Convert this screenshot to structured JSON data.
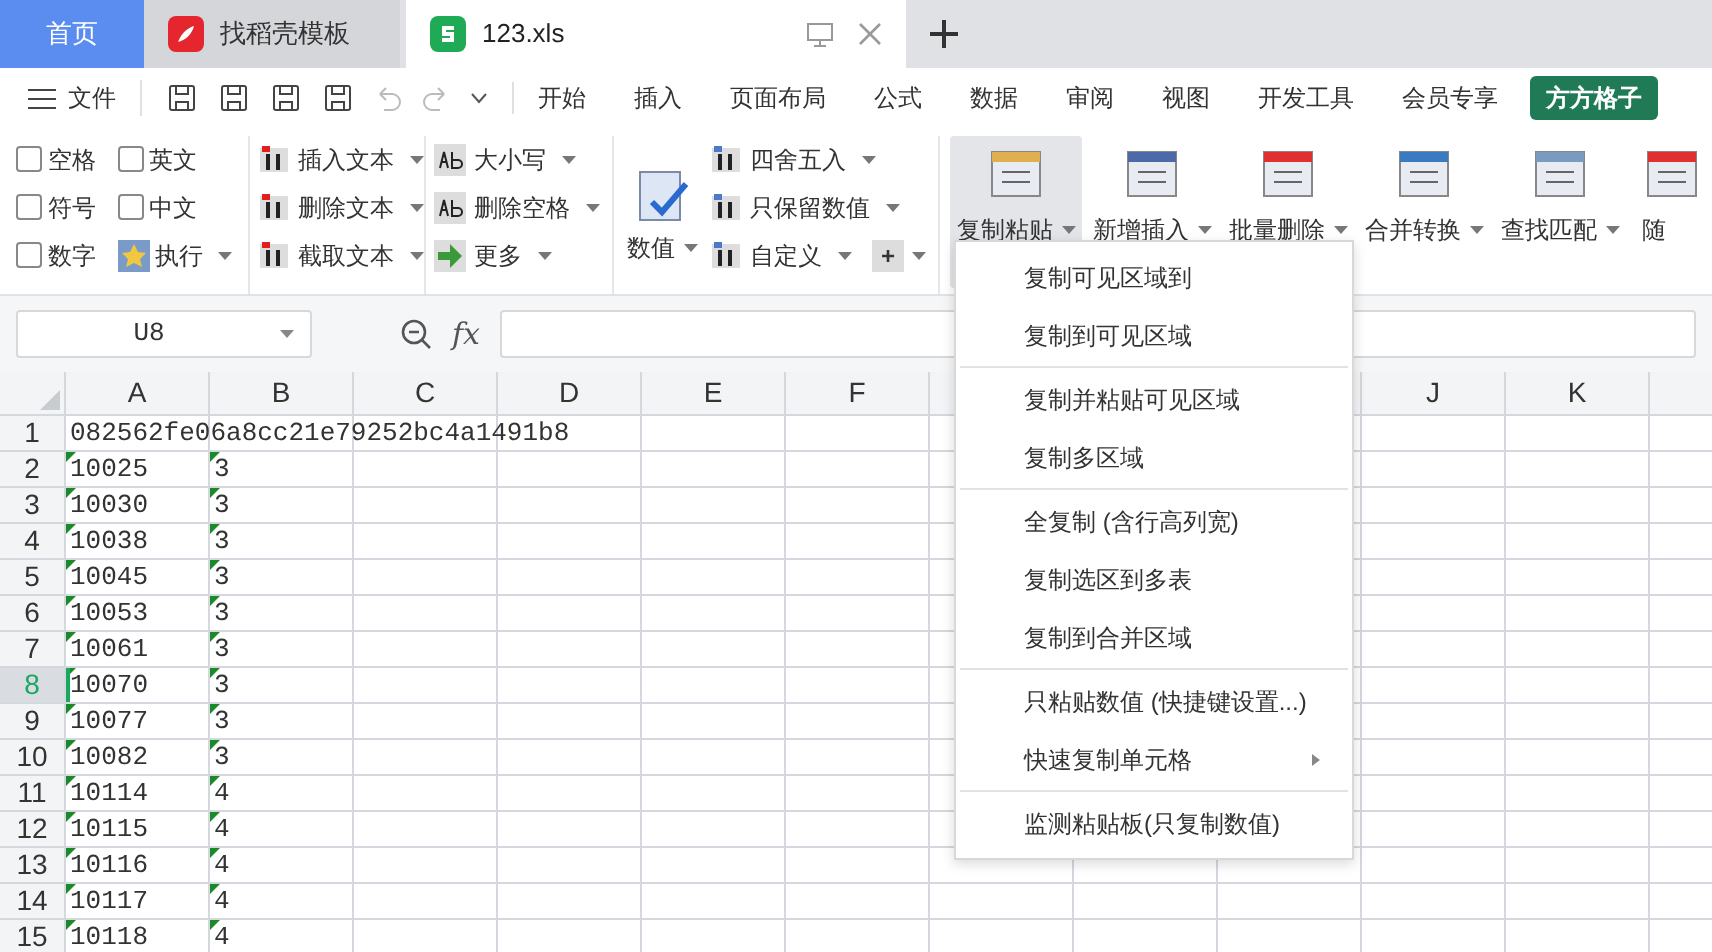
{
  "tabs": [
    {
      "label": "首页",
      "kind": "home",
      "selected": false
    },
    {
      "label": "找稻壳模板",
      "kind": "template",
      "selected": false
    },
    {
      "label": "123.xls",
      "kind": "sheet",
      "selected": true
    }
  ],
  "menu": {
    "file": "文件",
    "tabs": [
      "开始",
      "插入",
      "页面布局",
      "公式",
      "数据",
      "审阅",
      "视图",
      "开发工具",
      "会员专享"
    ],
    "brand": "方方格子"
  },
  "ribbon": {
    "checkboxes": [
      {
        "label": "空格",
        "checked": false
      },
      {
        "label": "英文",
        "checked": false
      },
      {
        "label": "符号",
        "checked": false
      },
      {
        "label": "中文",
        "checked": false
      },
      {
        "label": "数字",
        "checked": false
      }
    ],
    "execute": "执行",
    "text_tools": [
      "插入文本",
      "删除文本",
      "截取文本"
    ],
    "case_tools": [
      "大小写",
      "删除空格",
      "更多"
    ],
    "value_big": "数值",
    "value_tools": [
      "四舍五入",
      "只保留数值",
      "自定义"
    ],
    "plus": "+",
    "big_buttons": [
      {
        "label": "复制粘贴",
        "selected": true
      },
      {
        "label": "新增插入",
        "selected": false
      },
      {
        "label": "批量删除",
        "selected": false
      },
      {
        "label": "合并转换",
        "selected": false
      },
      {
        "label": "查找匹配",
        "selected": false
      },
      {
        "label": "随",
        "selected": false
      }
    ]
  },
  "formula_bar": {
    "name_box": "U8",
    "fx": "fx"
  },
  "columns": [
    {
      "label": "A"
    },
    {
      "label": "B"
    },
    {
      "label": "C"
    },
    {
      "label": "D"
    },
    {
      "label": "E"
    },
    {
      "label": "F"
    },
    {
      "label": "J"
    },
    {
      "label": "K"
    }
  ],
  "rows": [
    {
      "n": "1",
      "a": "082562fe06a8cc21e79252bc4a1491b8",
      "selected": false
    },
    {
      "n": "2",
      "a": "10025",
      "b": "3",
      "selected": false,
      "text_marker": true
    },
    {
      "n": "3",
      "a": "10030",
      "b": "3",
      "selected": false,
      "text_marker": true
    },
    {
      "n": "4",
      "a": "10038",
      "b": "3",
      "selected": false,
      "text_marker": true
    },
    {
      "n": "5",
      "a": "10045",
      "b": "3",
      "selected": false,
      "text_marker": true
    },
    {
      "n": "6",
      "a": "10053",
      "b": "3",
      "selected": false,
      "text_marker": true
    },
    {
      "n": "7",
      "a": "10061",
      "b": "3",
      "selected": false,
      "text_marker": true
    },
    {
      "n": "8",
      "a": "10070",
      "b": "3",
      "selected": true,
      "text_marker": true
    },
    {
      "n": "9",
      "a": "10077",
      "b": "3",
      "selected": false,
      "text_marker": true
    },
    {
      "n": "10",
      "a": "10082",
      "b": "3",
      "selected": false,
      "text_marker": true
    },
    {
      "n": "11",
      "a": "10114",
      "b": "4",
      "selected": false,
      "text_marker": true
    },
    {
      "n": "12",
      "a": "10115",
      "b": "4",
      "selected": false,
      "text_marker": true
    },
    {
      "n": "13",
      "a": "10116",
      "b": "4",
      "selected": false,
      "text_marker": true
    },
    {
      "n": "14",
      "a": "10117",
      "b": "4",
      "selected": false,
      "text_marker": true
    },
    {
      "n": "15",
      "a": "10118",
      "b": "4",
      "selected": false,
      "text_marker": true
    }
  ],
  "dropdown": {
    "groups": [
      [
        {
          "label": "复制可见区域到"
        },
        {
          "label": "复制到可见区域"
        }
      ],
      [
        {
          "label": "复制并粘贴可见区域"
        },
        {
          "label": "复制多区域"
        }
      ],
      [
        {
          "label": "全复制 (含行高列宽)"
        },
        {
          "label": "复制选区到多表"
        },
        {
          "label": "复制到合并区域"
        }
      ],
      [
        {
          "label": "只粘贴数值 (快捷键设置...)"
        },
        {
          "label": "快速复制单元格",
          "submenu": true
        }
      ],
      [
        {
          "label": "监测粘贴板(只复制数值)"
        }
      ]
    ]
  }
}
